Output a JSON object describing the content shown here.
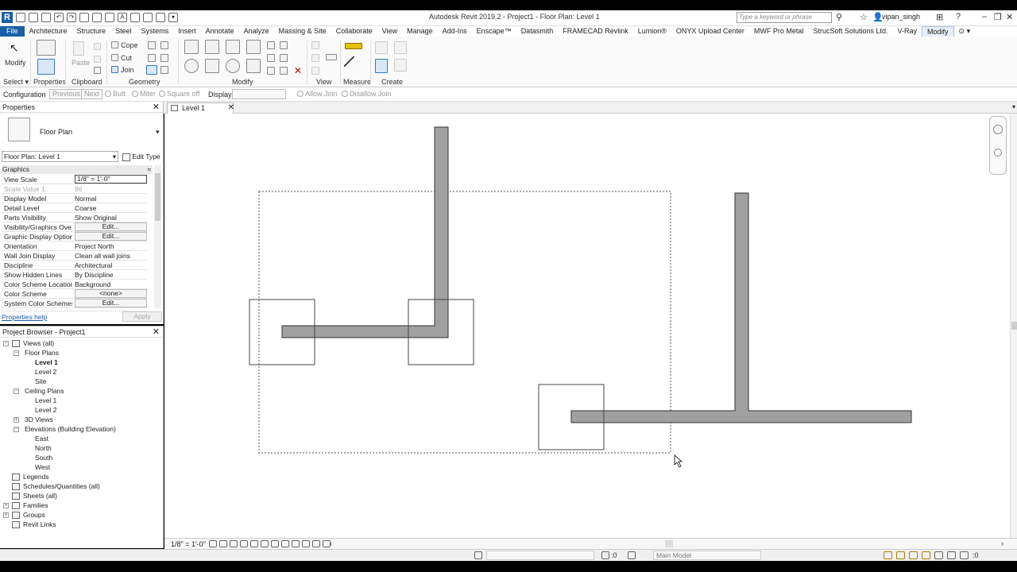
{
  "app": {
    "title": "Autodesk Revit 2019.2 - Project1 - Floor Plan: Level 1",
    "search_placeholder": "Type a keyword or phrase",
    "user": "vipan_singh"
  },
  "menu": {
    "tabs": [
      "File",
      "Architecture",
      "Structure",
      "Steel",
      "Systems",
      "Insert",
      "Annotate",
      "Analyze",
      "Massing & Site",
      "Collaborate",
      "View",
      "Manage",
      "Add-Ins",
      "Enscape™",
      "Datasmith",
      "FRAMECAD Revlink",
      "Lumion®",
      "ONYX Upload Center",
      "MWF Pro Metal",
      "StrucSoft Solutions Ltd.",
      "V-Ray",
      "Modify"
    ],
    "active": "Modify"
  },
  "ribbon": {
    "modify_label": "Modify",
    "select_label": "Select ▾",
    "properties_label": "Properties",
    "paste_label": "Paste",
    "clipboard_label": "Clipboard",
    "cope_label": "Cope",
    "cut_label": "Cut",
    "join_label": "Join",
    "geometry_label": "Geometry",
    "modify_panel_label": "Modify",
    "view_label": "View",
    "measure_label": "Measure",
    "create_label": "Create"
  },
  "options_bar": {
    "configuration": "Configuration",
    "previous": "Previous",
    "next": "Next",
    "butt": "Butt",
    "miter": "Miter",
    "square_off": "Square off",
    "display": "Display",
    "allow_join": "Allow Join",
    "disallow_join": "Disallow Join"
  },
  "properties": {
    "title": "Properties",
    "type_name": "Floor Plan",
    "selector": "Floor Plan: Level 1",
    "edit_type": "Edit Type",
    "group": "Graphics",
    "rows": [
      {
        "key": "View Scale",
        "value": "1/8\" = 1'-0\"",
        "kind": "box"
      },
      {
        "key": "Scale Value    1:",
        "value": "96",
        "kind": "dim"
      },
      {
        "key": "Display Model",
        "value": "Normal",
        "kind": "text"
      },
      {
        "key": "Detail Level",
        "value": "Coarse",
        "kind": "text"
      },
      {
        "key": "Parts Visibility",
        "value": "Show Original",
        "kind": "text"
      },
      {
        "key": "Visibility/Graphics Ove...",
        "value": "Edit...",
        "kind": "button"
      },
      {
        "key": "Graphic Display Options",
        "value": "Edit...",
        "kind": "button"
      },
      {
        "key": "Orientation",
        "value": "Project North",
        "kind": "text"
      },
      {
        "key": "Wall Join Display",
        "value": "Clean all wall joins",
        "kind": "text"
      },
      {
        "key": "Discipline",
        "value": "Architectural",
        "kind": "text"
      },
      {
        "key": "Show Hidden Lines",
        "value": "By Discipline",
        "kind": "text"
      },
      {
        "key": "Color Scheme Location",
        "value": "Background",
        "kind": "text"
      },
      {
        "key": "Color Scheme",
        "value": "<none>",
        "kind": "button"
      },
      {
        "key": "System Color Schemes",
        "value": "Edit...",
        "kind": "button"
      }
    ],
    "help_link": "Properties help",
    "apply": "Apply"
  },
  "browser": {
    "title": "Project Browser - Project1",
    "items": [
      {
        "label": "Views (all)",
        "level": 0,
        "toggle": "-",
        "bold": false
      },
      {
        "label": "Floor Plans",
        "level": 1,
        "toggle": "-",
        "bold": false
      },
      {
        "label": "Level 1",
        "level": 2,
        "toggle": "",
        "bold": true
      },
      {
        "label": "Level 2",
        "level": 2,
        "toggle": "",
        "bold": false
      },
      {
        "label": "Site",
        "level": 2,
        "toggle": "",
        "bold": false
      },
      {
        "label": "Ceiling Plans",
        "level": 1,
        "toggle": "-",
        "bold": false
      },
      {
        "label": "Level 1",
        "level": 2,
        "toggle": "",
        "bold": false
      },
      {
        "label": "Level 2",
        "level": 2,
        "toggle": "",
        "bold": false
      },
      {
        "label": "3D Views",
        "level": 1,
        "toggle": "+",
        "bold": false
      },
      {
        "label": "Elevations (Building Elevation)",
        "level": 1,
        "toggle": "-",
        "bold": false
      },
      {
        "label": "East",
        "level": 2,
        "toggle": "",
        "bold": false
      },
      {
        "label": "North",
        "level": 2,
        "toggle": "",
        "bold": false
      },
      {
        "label": "South",
        "level": 2,
        "toggle": "",
        "bold": false
      },
      {
        "label": "West",
        "level": 2,
        "toggle": "",
        "bold": false
      },
      {
        "label": "Legends",
        "level": 0,
        "toggle": "",
        "bold": false
      },
      {
        "label": "Schedules/Quantities (all)",
        "level": 0,
        "toggle": "",
        "bold": false
      },
      {
        "label": "Sheets (all)",
        "level": 0,
        "toggle": "",
        "bold": false
      },
      {
        "label": "Families",
        "level": 0,
        "toggle": "+",
        "bold": false
      },
      {
        "label": "Groups",
        "level": 0,
        "toggle": "+",
        "bold": false
      },
      {
        "label": "Revit Links",
        "level": 0,
        "toggle": "",
        "bold": false
      }
    ]
  },
  "view": {
    "tab_label": "Level 1",
    "scale": "1/8\" = 1'-0\"",
    "status_count": ":0",
    "model": "Main Model",
    "filter_count": ":0"
  },
  "colors": {
    "wall_fill": "#a0a0a0",
    "wall_stroke": "#333333",
    "accent": "#1a5fa8"
  }
}
